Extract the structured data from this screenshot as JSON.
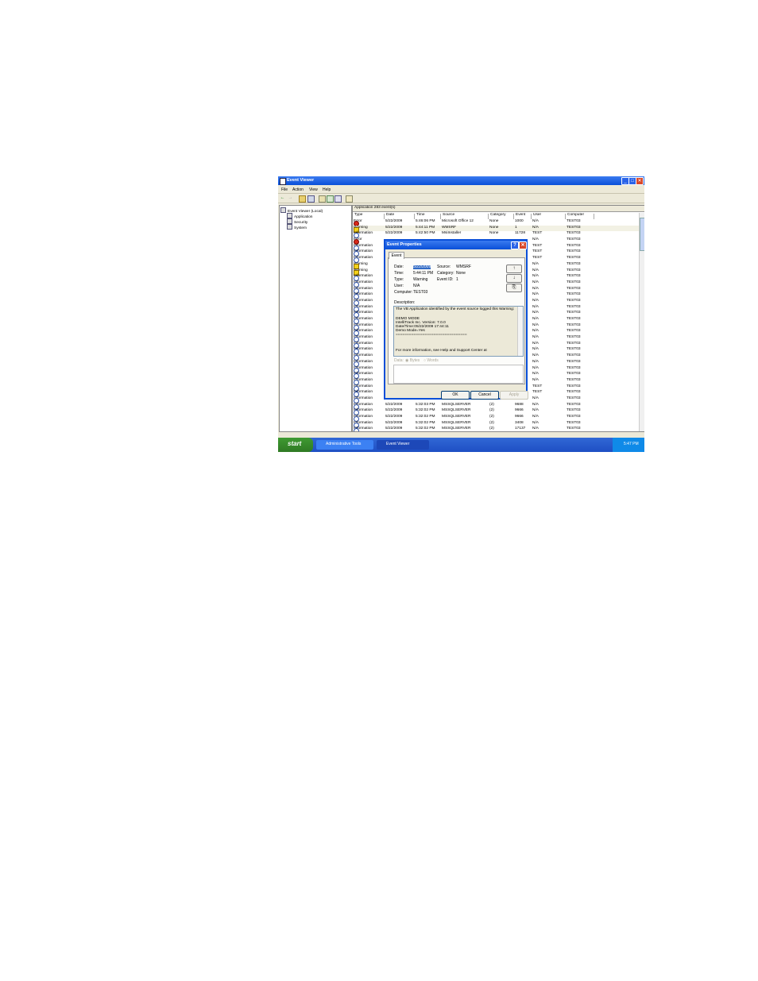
{
  "window": {
    "title": "Event Viewer",
    "min": "_",
    "max": "□",
    "close": "✕"
  },
  "menu": [
    "File",
    "Action",
    "View",
    "Help"
  ],
  "tree": {
    "root": "Event Viewer (Local)",
    "items": [
      "Application",
      "Security",
      "System"
    ]
  },
  "pane": {
    "title": "Application   283 event(s)",
    "columns": [
      "Type",
      "Date",
      "Time",
      "Source",
      "Category",
      "Event",
      "User",
      "Computer"
    ]
  },
  "events": [
    {
      "type": "err",
      "label": "Error",
      "date": "5/22/2009",
      "time": "5:46:06 PM",
      "source": "Microsoft Office 12",
      "category": "None",
      "event": "1000",
      "user": "N/A",
      "computer": "TEST03"
    },
    {
      "type": "warn",
      "label": "Warning",
      "date": "5/22/2009",
      "time": "5:44:11 PM",
      "source": "WMSRF",
      "category": "None",
      "event": "1",
      "user": "N/A",
      "computer": "TEST03"
    },
    {
      "type": "info",
      "label": "Information",
      "date": "5/22/2009",
      "time": "5:42:50 PM",
      "source": "MsiInstaller",
      "category": "None",
      "event": "11728",
      "user": "TEST",
      "computer": "TEST03"
    },
    {
      "type": "err",
      "label": "Error",
      "user": "N/A",
      "computer": "TEST03"
    },
    {
      "type": "info",
      "label": "Information",
      "user": "TEST",
      "computer": "TEST03"
    },
    {
      "type": "info",
      "label": "Information",
      "user": "TEST",
      "computer": "TEST03"
    },
    {
      "type": "info",
      "label": "Information",
      "user": "TEST",
      "computer": "TEST03"
    },
    {
      "type": "warn",
      "label": "Warning",
      "user": "N/A",
      "computer": "TEST03"
    },
    {
      "type": "warn",
      "label": "Warning",
      "user": "N/A",
      "computer": "TEST03"
    },
    {
      "type": "info",
      "label": "Information",
      "user": "N/A",
      "computer": "TEST03"
    },
    {
      "type": "info",
      "label": "Information",
      "user": "N/A",
      "computer": "TEST03"
    },
    {
      "type": "info",
      "label": "Information",
      "user": "N/A",
      "computer": "TEST03"
    },
    {
      "type": "info",
      "label": "Information",
      "user": "N/A",
      "computer": "TEST03"
    },
    {
      "type": "info",
      "label": "Information",
      "user": "N/A",
      "computer": "TEST03"
    },
    {
      "type": "info",
      "label": "Information",
      "user": "N/A",
      "computer": "TEST03"
    },
    {
      "type": "info",
      "label": "Information",
      "user": "N/A",
      "computer": "TEST03"
    },
    {
      "type": "info",
      "label": "Information",
      "user": "N/A",
      "computer": "TEST03"
    },
    {
      "type": "info",
      "label": "Information",
      "user": "N/A",
      "computer": "TEST03"
    },
    {
      "type": "info",
      "label": "Information",
      "user": "N/A",
      "computer": "TEST03"
    },
    {
      "type": "info",
      "label": "Information",
      "user": "N/A",
      "computer": "TEST03"
    },
    {
      "type": "info",
      "label": "Information",
      "user": "N/A",
      "computer": "TEST03"
    },
    {
      "type": "info",
      "label": "Information",
      "user": "N/A",
      "computer": "TEST03"
    },
    {
      "type": "info",
      "label": "Information",
      "user": "N/A",
      "computer": "TEST03"
    },
    {
      "type": "info",
      "label": "Information",
      "user": "N/A",
      "computer": "TEST03"
    },
    {
      "type": "info",
      "label": "Information",
      "user": "N/A",
      "computer": "TEST03"
    },
    {
      "type": "info",
      "label": "Information",
      "user": "N/A",
      "computer": "TEST03"
    },
    {
      "type": "info",
      "label": "Information",
      "user": "N/A",
      "computer": "TEST03"
    },
    {
      "type": "info",
      "label": "Information",
      "user": "TEST",
      "computer": "TEST03"
    },
    {
      "type": "info",
      "label": "Information",
      "user": "TEST",
      "computer": "TEST03"
    },
    {
      "type": "info",
      "label": "Information",
      "user": "N/A",
      "computer": "TEST03"
    },
    {
      "type": "info",
      "label": "Information",
      "date": "5/22/2009",
      "time": "5:32:03 PM",
      "source": "MSSQLSERVER",
      "category": "(2)",
      "event": "9688",
      "user": "N/A",
      "computer": "TEST03"
    },
    {
      "type": "info",
      "label": "Information",
      "date": "5/22/2009",
      "time": "5:32:02 PM",
      "source": "MSSQLSERVER",
      "category": "(2)",
      "event": "9666",
      "user": "N/A",
      "computer": "TEST03"
    },
    {
      "type": "info",
      "label": "Information",
      "date": "5/22/2009",
      "time": "5:32:02 PM",
      "source": "MSSQLSERVER",
      "category": "(2)",
      "event": "9666",
      "user": "N/A",
      "computer": "TEST03"
    },
    {
      "type": "info",
      "label": "Information",
      "date": "5/22/2009",
      "time": "5:32:02 PM",
      "source": "MSSQLSERVER",
      "category": "(2)",
      "event": "3408",
      "user": "N/A",
      "computer": "TEST03"
    },
    {
      "type": "info",
      "label": "Information",
      "date": "5/22/2009",
      "time": "5:32:02 PM",
      "source": "MSSQLSERVER",
      "category": "(2)",
      "event": "17137",
      "user": "N/A",
      "computer": "TEST03"
    }
  ],
  "dialog": {
    "title": "Event Properties",
    "help": "?",
    "close": "✕",
    "tab": "Event",
    "date_label": "Date:",
    "date_value": "5/22/2009",
    "source_label": "Source:",
    "source_value": "WMSRF",
    "time_label": "Time:",
    "time_value": "5:44:11 PM",
    "category_label": "Category:",
    "category_value": "None",
    "type_label": "Type:",
    "type_value": "Warning",
    "eventid_label": "Event ID:",
    "eventid_value": "1",
    "user_label": "User:",
    "user_value": "N/A",
    "computer_label": "Computer:",
    "computer_value": "TEST03",
    "up": "↑",
    "down": "↓",
    "copy": "⎘",
    "description_label": "Description:",
    "description_lines": [
      "The VB Application identified by the event source logged this Warning:",
      "",
      "DEMO MODE",
      "IntelliTrack Inc. Version: 7.0.0",
      "Date/Time:05/22/2009 17:44:11",
      "Demo Mode=Yes",
      "================================",
      "",
      "",
      "For more information, see Help and Support Center at"
    ],
    "data_label": "Data:",
    "bytes_label": "Bytes",
    "words_label": "Words",
    "ok": "OK",
    "cancel": "Cancel",
    "apply": "Apply"
  },
  "taskbar": {
    "start": "start",
    "items": [
      "Administrative Tools",
      "Event Viewer"
    ],
    "clock": "5:47 PM"
  }
}
